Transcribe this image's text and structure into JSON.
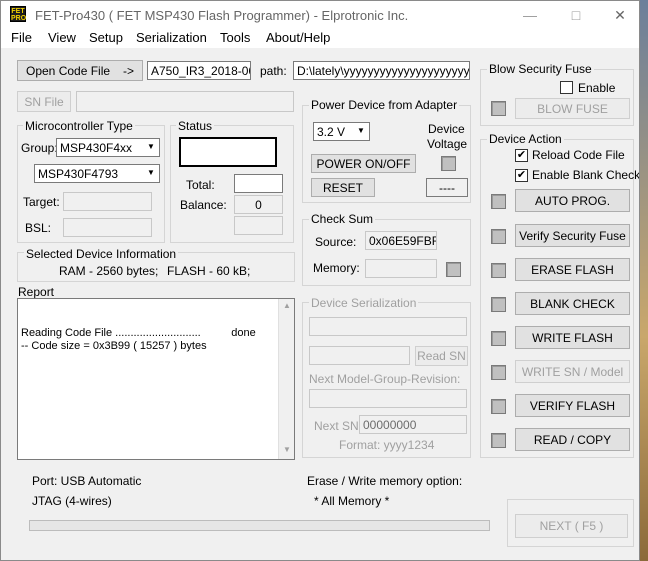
{
  "window": {
    "title": "FET-Pro430  ( FET MSP430 Flash Programmer)  -  Elprotronic Inc.",
    "minimize": "—",
    "maximize": "□",
    "close": "✕",
    "icon_text": "FET\nPRO"
  },
  "menu": [
    "File",
    "View",
    "Setup",
    "Serialization",
    "Tools",
    "About/Help"
  ],
  "code_file": {
    "button": "Open Code File",
    "arrow": "->",
    "filename": "A750_IR3_2018-06-1",
    "path_label": "path:",
    "path": "D:\\lately\\yyyyyyyyyyyyyyyyyyyyyy"
  },
  "sn_file": {
    "button": "SN File",
    "value": ""
  },
  "microcontroller": {
    "title": "Microcontroller Type",
    "group_label": "Group:",
    "group_value": "MSP430F4xx",
    "device_value": "MSP430F4793",
    "target_label": "Target:",
    "bsl_label": "BSL:"
  },
  "status": {
    "title": "Status",
    "total_label": "Total:",
    "total_value": "",
    "balance_label": "Balance:",
    "balance_value": "0"
  },
  "power": {
    "title": "Power Device from Adapter",
    "voltage_value": "3.2 V",
    "device_label_1": "Device",
    "device_label_2": "Voltage",
    "power_button": "POWER ON/OFF",
    "reset_button": "RESET",
    "voltage_readout": "----"
  },
  "checksum": {
    "title": "Check Sum",
    "source_label": "Source:",
    "source_value": "0x06E59FBF",
    "memory_label": "Memory:"
  },
  "selected_device": {
    "title": "Selected Device Information",
    "ram": "RAM -  2560 bytes;",
    "flash": "FLASH - 60 kB;"
  },
  "report": {
    "title": "Report",
    "lines": "Reading Code File ............................          done\n-- Code size = 0x3B99 ( 15257 ) bytes"
  },
  "serialization": {
    "title": "Device Serialization",
    "read_sn_button": "Read SN",
    "next_model_label": "Next Model-Group-Revision:",
    "next_sn_label": "Next SN:",
    "next_sn_value": "00000000",
    "format_label": "Format: yyyy1234"
  },
  "blow_fuse": {
    "title": "Blow Security Fuse",
    "enable_label": "Enable",
    "enabled": false,
    "button": "BLOW FUSE"
  },
  "device_action": {
    "title": "Device Action",
    "reload_label": "Reload Code File",
    "reload_checked": true,
    "blank_label": "Enable Blank Check",
    "blank_checked": true,
    "buttons": [
      "AUTO PROG.",
      "Verify Security Fuse",
      "ERASE FLASH",
      "BLANK CHECK",
      "WRITE FLASH",
      "WRITE SN / Model",
      "VERIFY FLASH",
      "READ / COPY"
    ]
  },
  "footer": {
    "port": "Port: USB Automatic",
    "jtag": "JTAG (4-wires)",
    "erase_option_label": "Erase / Write memory option:",
    "erase_option_value": "* All Memory *",
    "next_button": "NEXT  ( F5 )",
    "progress": 0
  },
  "colors": {
    "window_bg": "#f0f0f0",
    "button_bg": "#e1e1e1",
    "disabled_text": "#a0a0a0",
    "led_gray": "#c0c0c0"
  }
}
